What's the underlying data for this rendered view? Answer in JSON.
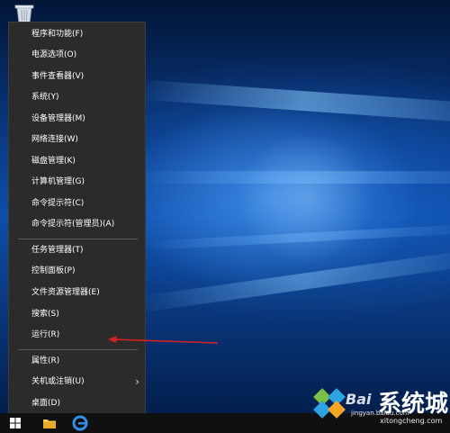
{
  "desktop": {
    "left_text": ""
  },
  "context_menu": {
    "groups": [
      [
        {
          "label": "程序和功能(F)"
        },
        {
          "label": "电源选项(O)"
        },
        {
          "label": "事件查看器(V)"
        },
        {
          "label": "系统(Y)"
        },
        {
          "label": "设备管理器(M)"
        },
        {
          "label": "网络连接(W)"
        },
        {
          "label": "磁盘管理(K)"
        },
        {
          "label": "计算机管理(G)"
        },
        {
          "label": "命令提示符(C)"
        },
        {
          "label": "命令提示符(管理员)(A)"
        }
      ],
      [
        {
          "label": "任务管理器(T)"
        },
        {
          "label": "控制面板(P)"
        },
        {
          "label": "文件资源管理器(E)"
        },
        {
          "label": "搜索(S)"
        },
        {
          "label": "运行(R)"
        }
      ],
      [
        {
          "label": "属性(R)"
        },
        {
          "label": "关机或注销(U)",
          "submenu": true
        },
        {
          "label": "桌面(D)"
        }
      ]
    ]
  },
  "annotation": {
    "arrow_color": "#d42222",
    "target": "运行(R)"
  },
  "taskbar": {
    "icons": [
      "windows-logo-icon",
      "file-explorer-icon",
      "edge-icon"
    ]
  },
  "watermark": {
    "brand": "Bai",
    "title": "系统城",
    "url_line1": "jingyan.baidu.com",
    "url_line2": "xitongcheng.com"
  },
  "colors": {
    "menu_bg": "#2b2b2b",
    "menu_text": "#ffffff",
    "separator": "#5a5a5a",
    "taskbar_bg": "#101010",
    "accent": "#1e90ff"
  }
}
